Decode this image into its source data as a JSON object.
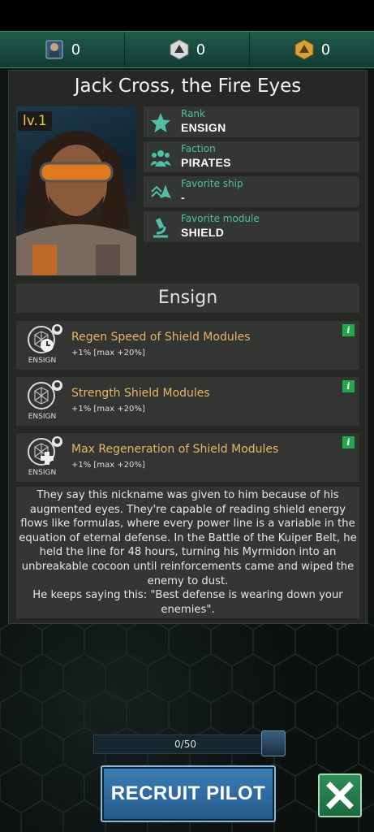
{
  "resources": [
    {
      "icon": "pilot-card-icon",
      "value": "0"
    },
    {
      "icon": "silver-badge-icon",
      "value": "0"
    },
    {
      "icon": "gold-badge-icon",
      "value": "0"
    }
  ],
  "pilot": {
    "name": "Jack Cross, the Fire Eyes",
    "level": "lv.1",
    "info": [
      {
        "icon": "star-icon",
        "label": "Rank",
        "value": "ENSIGN"
      },
      {
        "icon": "group-icon",
        "label": "Faction",
        "value": "PIRATES"
      },
      {
        "icon": "ship-icon",
        "label": "Favorite ship",
        "value": "-"
      },
      {
        "icon": "microscope-icon",
        "label": "Favorite module",
        "value": "SHIELD"
      }
    ]
  },
  "rank_section": "Ensign",
  "skills": [
    {
      "name": "Regen Speed of Shield Modules",
      "bonus": "+1% [max +20%]",
      "tag": "ENSIGN",
      "icon": "shield-timer-icon"
    },
    {
      "name": "Strength Shield Modules",
      "bonus": "+1% [max +20%]",
      "tag": "ENSIGN",
      "icon": "shield-hex-icon"
    },
    {
      "name": "Max Regeneration of Shield Modules",
      "bonus": "+1% [max +20%]",
      "tag": "ENSIGN",
      "icon": "shield-plus-icon"
    }
  ],
  "lore": {
    "paragraph": "They say this nickname was given to him because of his augmented eyes. They're capable of reading shield energy flows like formulas, where every power line is a variable in the equation of eternal defense. In the Battle of the Kuiper Belt, he held the line for 48 hours, turning his Myrmidon into an unbreakable cocoon until reinforcements came and wiped the enemy to dust.",
    "quote": "He keeps saying this: \"Best defense is wearing down your enemies\"."
  },
  "progress": {
    "text": "0/50",
    "fraction": 0
  },
  "recruit_label": "RECRUIT PILOT",
  "colors": {
    "accent_green": "#1f5a4b",
    "label_teal": "#4fbfa5",
    "skill_gold": "#e7b46a",
    "button_blue": "#2e6b9e"
  }
}
